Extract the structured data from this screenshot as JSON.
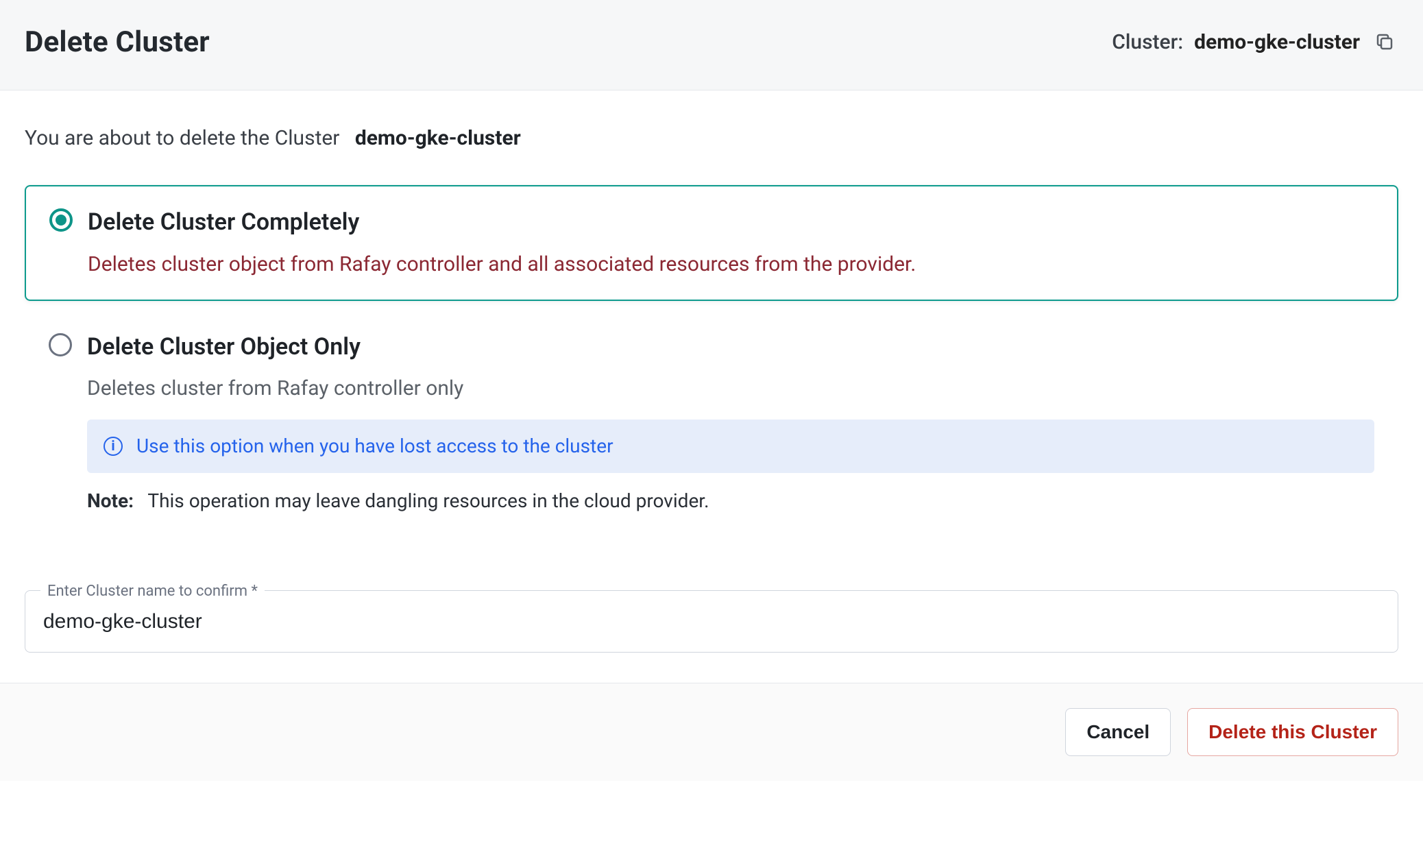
{
  "header": {
    "title": "Delete Cluster",
    "cluster_prefix": "Cluster:",
    "cluster_name": "demo-gke-cluster"
  },
  "intro": {
    "prefix": "You are about to delete the Cluster",
    "name": "demo-gke-cluster"
  },
  "options": {
    "completely": {
      "title": "Delete Cluster Completely",
      "description": "Deletes cluster object from Rafay controller and all associated resources from the provider.",
      "selected": true
    },
    "object_only": {
      "title": "Delete Cluster Object Only",
      "description": "Deletes cluster from Rafay controller only",
      "info": "Use this option when you have lost access to the cluster",
      "note_label": "Note:",
      "note_text": "This operation may leave dangling resources in the cloud provider."
    }
  },
  "confirm": {
    "label": "Enter Cluster name to confirm *",
    "value": "demo-gke-cluster"
  },
  "footer": {
    "cancel": "Cancel",
    "delete": "Delete this Cluster"
  },
  "icons": {
    "copy": "copy-icon",
    "info": "info-icon"
  }
}
